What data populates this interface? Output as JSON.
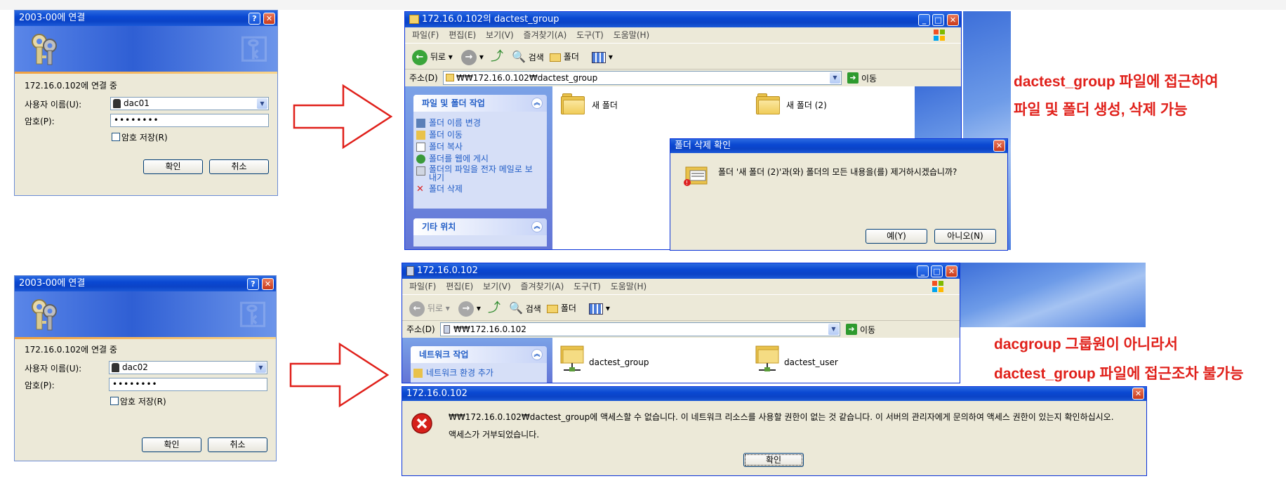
{
  "login_top": {
    "title": "2003-00에 연결",
    "connecting": "172.16.0.102에 연결 중",
    "username_label": "사용자 이름(U):",
    "username_value": "dac01",
    "password_label": "암호(P):",
    "password_value": "••••••••",
    "remember_label": "암호 저장(R)",
    "ok_label": "확인",
    "cancel_label": "취소"
  },
  "login_bottom": {
    "title": "2003-00에 연결",
    "connecting": "172.16.0.102에 연결 중",
    "username_label": "사용자 이름(U):",
    "username_value": "dac02",
    "password_label": "암호(P):",
    "password_value": "••••••••",
    "remember_label": "암호 저장(R)",
    "ok_label": "확인",
    "cancel_label": "취소"
  },
  "explorer_top": {
    "title": "172.16.0.102의 dactest_group",
    "menu": [
      "파일(F)",
      "편집(E)",
      "보기(V)",
      "즐겨찾기(A)",
      "도구(T)",
      "도움말(H)"
    ],
    "back_label": "뒤로",
    "search_label": "검색",
    "folders_label": "폴더",
    "address_label": "주소(D)",
    "address_value": "₩₩172.16.0.102₩dactest_group",
    "go_label": "이동",
    "task_header": "파일 및 폴더 작업",
    "tasks": [
      "폴더 이름 변경",
      "폴더 이동",
      "폴더 복사",
      "폴더를 웹에 게시",
      "폴더의 파일을 전자 메일로 보내기",
      "폴더 삭제"
    ],
    "other_header": "기타 위치",
    "folder1": "새 폴더",
    "folder2": "새 폴더 (2)"
  },
  "confirm_dialog": {
    "title": "폴더 삭제 확인",
    "message": "폴더 '새 폴더 (2)'과(와) 폴더의 모든 내용을(를) 제거하시겠습니까?",
    "yes_label": "예(Y)",
    "no_label": "아니오(N)"
  },
  "explorer_bottom": {
    "title": "172.16.0.102",
    "menu": [
      "파일(F)",
      "편집(E)",
      "보기(V)",
      "즐겨찾기(A)",
      "도구(T)",
      "도움말(H)"
    ],
    "back_label": "뒤로",
    "search_label": "검색",
    "folders_label": "폴더",
    "address_label": "주소(D)",
    "address_value": "₩₩172.16.0.102",
    "go_label": "이동",
    "task_header": "네트워크 작업",
    "task1": "네트워크 환경 추가",
    "share1": "dactest_group",
    "share2": "dactest_user"
  },
  "error_dialog": {
    "title": "172.16.0.102",
    "message": "₩₩172.16.0.102₩dactest_group에 액세스할 수 없습니다. 이 네트워크 리소스를 사용할 권한이 없는 것 같습니다. 이 서버의 관리자에게 문의하여 액세스 권한이 있는지 확인하십시오.",
    "denied": "액세스가 거부되었습니다.",
    "ok_label": "확인"
  },
  "annotations": {
    "top_line1": "dactest_group 파일에 접근하여",
    "top_line2": "파일 및 폴더 생성, 삭제 가능",
    "bottom_line1": "dacgroup 그룹원이 아니라서",
    "bottom_line2": "dactest_group 파일에 접근조차 불가능"
  },
  "colors": {
    "arrow": "#e0201a",
    "annotation_text": "#e0201a",
    "titlebar": "#0a48d2",
    "dialog_bg": "#ece9d8"
  }
}
